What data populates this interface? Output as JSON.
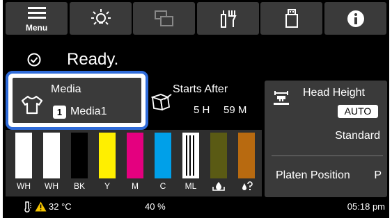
{
  "toolbar": {
    "menu_label": "Menu"
  },
  "status": {
    "text": "Ready."
  },
  "media": {
    "title": "Media",
    "number": "1",
    "name": "Media1"
  },
  "starts_after": {
    "title": "Starts After",
    "hours": "5 H",
    "minutes": "59 M"
  },
  "head_height": {
    "title": "Head Height",
    "mode": "AUTO",
    "setting": "Standard",
    "platen_label": "Platen Position",
    "platen_value": "P"
  },
  "inks": [
    {
      "label": "WH",
      "color": "#ffffff"
    },
    {
      "label": "WH",
      "color": "#ffffff"
    },
    {
      "label": "BK",
      "color": "#000000"
    },
    {
      "label": "Y",
      "color": "#ffef00"
    },
    {
      "label": "M",
      "color": "#e4007f"
    },
    {
      "label": "C",
      "color": "#00a0e9"
    },
    {
      "label": "ML",
      "color": "#ffffff"
    },
    {
      "label": "",
      "color": "#5a5a14"
    },
    {
      "label": "",
      "color": "#b86a10"
    }
  ],
  "bottom": {
    "temperature": "32 °C",
    "humidity": "40 %",
    "time": "05:18 pm"
  },
  "colors": {
    "accent": "#2f6bd8",
    "panel": "#3a3a3a",
    "warning": "#f5c400"
  }
}
